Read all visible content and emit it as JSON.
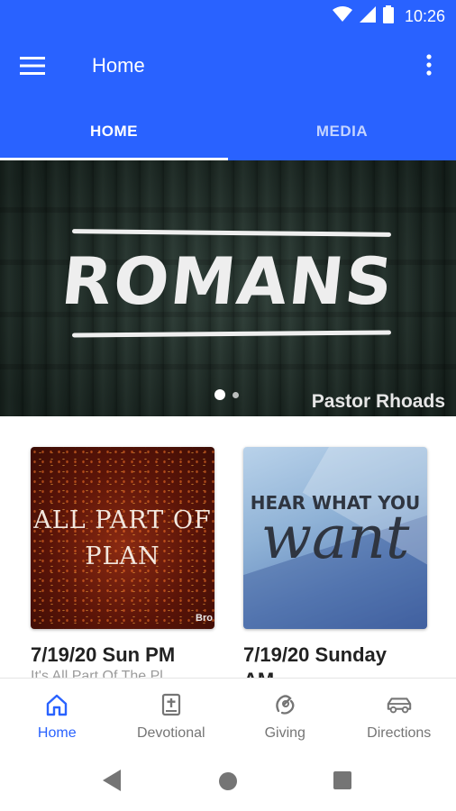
{
  "status_bar": {
    "time": "10:26",
    "icons": [
      "wifi-icon",
      "signal-icon",
      "battery-icon"
    ]
  },
  "app_bar": {
    "title": "Home",
    "menu_icon": "hamburger-icon",
    "more_icon": "more-vert-icon"
  },
  "tabs": [
    {
      "label": "HOME",
      "active": true
    },
    {
      "label": "MEDIA",
      "active": false
    }
  ],
  "hero": {
    "title": "ROMANS",
    "caption": "Pastor Rhoads",
    "slides": 2,
    "active_slide": 1
  },
  "cards": [
    {
      "thumb_lines": [
        "ALL PART OF",
        "PLAN"
      ],
      "thumb_tag": "Bro",
      "date": "7/19/20 Sun PM",
      "subtitle": "It's All Part Of The Pl..."
    },
    {
      "thumb_lines": [
        "HEAR WHAT YOU",
        "want"
      ],
      "date": "7/19/20 Sunday",
      "subtitle": "AM"
    }
  ],
  "bottom_nav": [
    {
      "label": "Home",
      "icon": "home-icon",
      "active": true
    },
    {
      "label": "Devotional",
      "icon": "bible-icon",
      "active": false
    },
    {
      "label": "Giving",
      "icon": "giving-icon",
      "active": false
    },
    {
      "label": "Directions",
      "icon": "car-icon",
      "active": false
    }
  ],
  "colors": {
    "primary": "#2962ff",
    "nav_inactive": "#757575",
    "text_dark": "#222222"
  }
}
